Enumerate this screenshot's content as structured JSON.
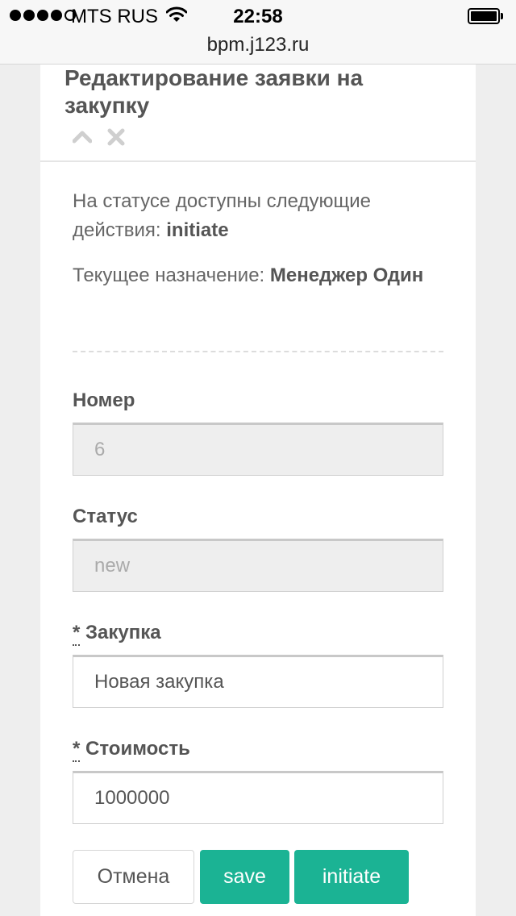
{
  "status_bar": {
    "carrier": "MTS RUS",
    "time": "22:58",
    "signal_bars_filled": 4,
    "signal_bars_total": 5,
    "wifi_icon": "wifi-icon",
    "battery_icon": "battery-icon"
  },
  "browser": {
    "url": "bpm.j123.ru"
  },
  "modal": {
    "title": "Редактирование заявки на закупку",
    "collapse_icon": "chevron-up-icon",
    "close_icon": "close-icon",
    "actions_prefix": "На статусе доступны следующие действия: ",
    "actions_value": "initiate",
    "assignment_prefix": "Текущее назначение: ",
    "assignment_value": "Менеджер Один"
  },
  "form": {
    "number": {
      "label": "Номер",
      "value": "6"
    },
    "status": {
      "label": "Статус",
      "value": "new"
    },
    "purchase": {
      "required_mark": "*",
      "label": "Закупка",
      "value": "Новая закупка"
    },
    "cost": {
      "required_mark": "*",
      "label": "Стоимость",
      "value": "1000000"
    }
  },
  "buttons": {
    "cancel": "Отмена",
    "save": "save",
    "initiate": "initiate"
  },
  "colors": {
    "accent": "#1bb394",
    "readonly_bg": "#eeeeee",
    "page_bg": "#eeeeee"
  }
}
